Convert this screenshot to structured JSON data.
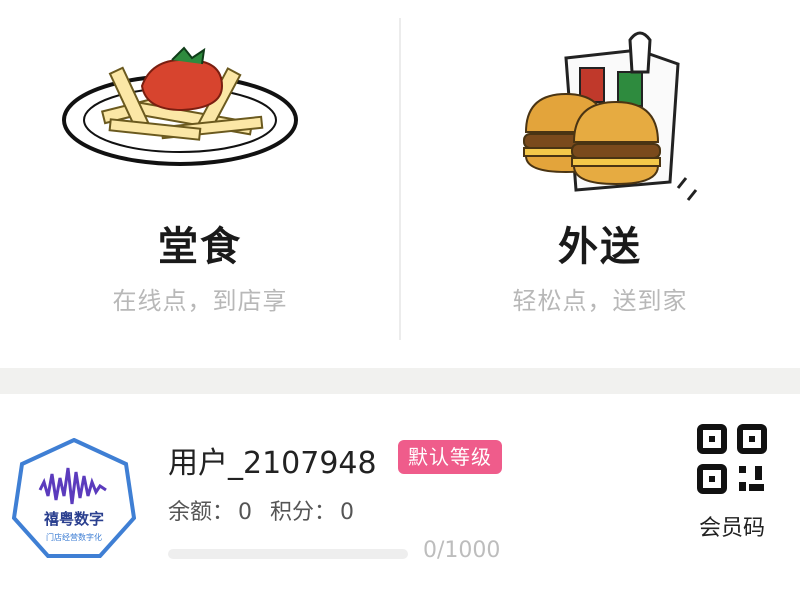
{
  "options": {
    "dine_in": {
      "title": "堂食",
      "subtitle": "在线点，到店享",
      "icon": "fries-plate-icon"
    },
    "delivery": {
      "title": "外送",
      "subtitle": "轻松点，送到家",
      "icon": "burger-takeout-icon"
    }
  },
  "member": {
    "avatar_text": "禧粤数字",
    "avatar_subtext": "门店经营数字化",
    "username": "用户_2107948",
    "level_badge": "默认等级",
    "balance_label": "余额：",
    "balance_value": "0",
    "points_label": "积分：",
    "points_value": "0",
    "progress_text": "0/1000",
    "progress_fraction": 0,
    "member_code_label": "会员码",
    "member_code_icon": "qr-code-icon"
  },
  "colors": {
    "accent_pink": "#ef5c8b",
    "avatar_border": "#3f7fd4",
    "band_gray": "#f1f1ef"
  }
}
